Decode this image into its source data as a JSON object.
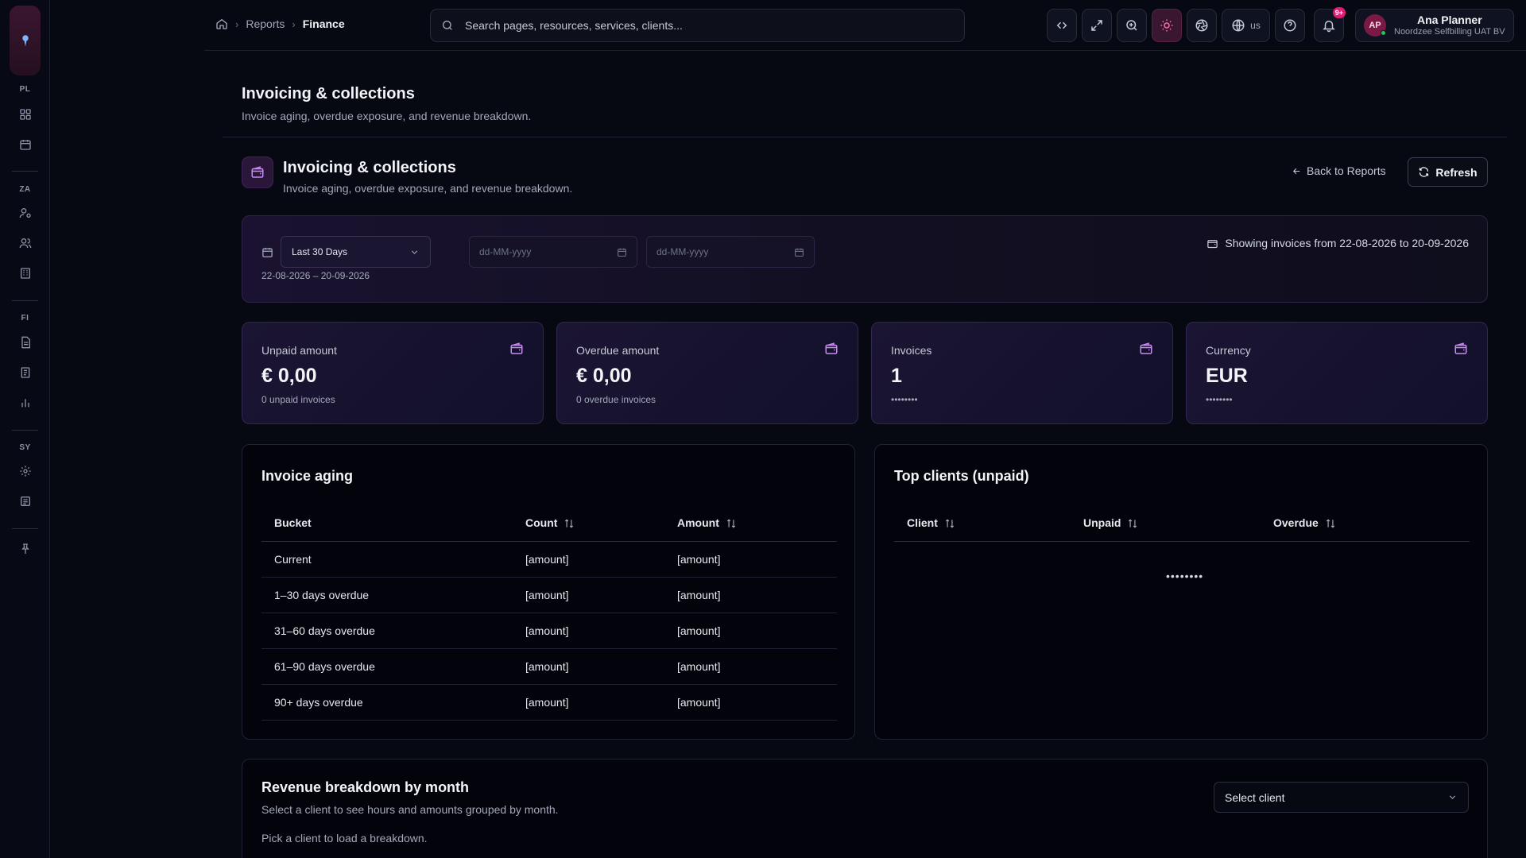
{
  "rail": {
    "sections": [
      "PL",
      "ZA",
      "FI",
      "SY"
    ]
  },
  "topbar": {
    "breadcrumbs": [
      "Reports",
      "Finance"
    ],
    "search_placeholder": "Search pages, resources, services, clients...",
    "language": "us",
    "notifications_badge": "9+",
    "user": {
      "initials": "AP",
      "name": "Ana Planner",
      "org": "Noordzee Selfbilling UAT BV"
    }
  },
  "page": {
    "title": "Invoicing & collections",
    "subtitle": "Invoice aging, overdue exposure, and revenue breakdown."
  },
  "section": {
    "title": "Invoicing & collections",
    "subtitle": "Invoice aging, overdue exposure, and revenue breakdown.",
    "back_label": "Back to Reports",
    "refresh_label": "Refresh"
  },
  "filter": {
    "period": "Last 30 Days",
    "from_placeholder": "dd-MM-yyyy",
    "to_placeholder": "dd-MM-yyyy",
    "range": "22-08-2026 – 20-09-2026",
    "showing": "Showing invoices from 22-08-2026 to 20-09-2026"
  },
  "stats": [
    {
      "label": "Unpaid amount",
      "value": "€ 0,00",
      "sub": "0 unpaid invoices"
    },
    {
      "label": "Overdue amount",
      "value": "€ 0,00",
      "sub": "0 overdue invoices"
    },
    {
      "label": "Invoices",
      "value": "1",
      "sub": "••••••••"
    },
    {
      "label": "Currency",
      "value": "EUR",
      "sub": "••••••••"
    }
  ],
  "aging": {
    "title": "Invoice aging",
    "columns": [
      "Bucket",
      "Count",
      "Amount"
    ],
    "rows": [
      [
        "Current",
        "[amount]",
        "[amount]"
      ],
      [
        "1–30 days overdue",
        "[amount]",
        "[amount]"
      ],
      [
        "31–60 days overdue",
        "[amount]",
        "[amount]"
      ],
      [
        "61–90 days overdue",
        "[amount]",
        "[amount]"
      ],
      [
        "90+ days overdue",
        "[amount]",
        "[amount]"
      ]
    ]
  },
  "top_clients": {
    "title": "Top clients (unpaid)",
    "columns": [
      "Client",
      "Unpaid",
      "Overdue"
    ],
    "loading": "••••••••"
  },
  "revenue": {
    "title": "Revenue breakdown by month",
    "subtitle": "Select a client to see hours and amounts grouped by month.",
    "empty": "Pick a client to load a breakdown.",
    "select_placeholder": "Select client"
  },
  "colors": {
    "accent": "#c88cf2",
    "active": "#ff6fb4",
    "badge": "#e01b74",
    "background": "#060812"
  }
}
